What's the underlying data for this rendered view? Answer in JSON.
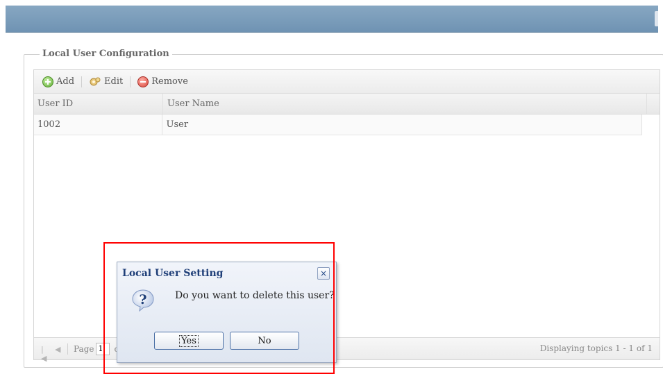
{
  "panel": {
    "title": "Local User Configuration"
  },
  "toolbar": {
    "add_label": "Add",
    "edit_label": "Edit",
    "remove_label": "Remove"
  },
  "grid": {
    "columns": [
      "User ID",
      "User Name"
    ],
    "rows": [
      {
        "user_id": "1002",
        "user_name": "User"
      }
    ]
  },
  "pager": {
    "page_label": "Page",
    "page_value": "1",
    "of_label": "of",
    "display_text": "Displaying topics 1 - 1 of 1"
  },
  "dialog": {
    "title": "Local User Setting",
    "message": "Do you want to delete this user?",
    "close_glyph": "×",
    "yes_label": "Yes",
    "no_label": "No"
  },
  "colors": {
    "header_bar": "#7b9bb8",
    "dialog_title": "#1f3f78",
    "highlight": "#ff0000"
  },
  "icons": [
    "add-icon",
    "edit-icon",
    "remove-icon",
    "first-page-icon",
    "prev-page-icon",
    "question-icon",
    "close-icon"
  ]
}
